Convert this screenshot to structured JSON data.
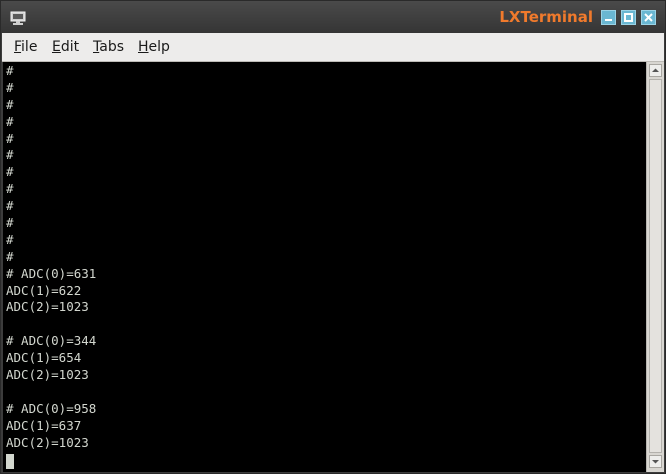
{
  "window": {
    "title": "LXTerminal",
    "title_color": "#f07a2c",
    "button_color": "#6ab7d2"
  },
  "menu": {
    "items": [
      {
        "mnemonic": "F",
        "rest": "ile"
      },
      {
        "mnemonic": "E",
        "rest": "dit"
      },
      {
        "mnemonic": "T",
        "rest": "abs"
      },
      {
        "mnemonic": "H",
        "rest": "elp"
      }
    ]
  },
  "terminal": {
    "background": "#000000",
    "foreground": "#d3d7cf",
    "lines": [
      "#",
      "#",
      "#",
      "#",
      "#",
      "#",
      "#",
      "#",
      "#",
      "#",
      "#",
      "#",
      "# ADC(0)=631",
      "ADC(1)=622",
      "ADC(2)=1023",
      "",
      "# ADC(0)=344",
      "ADC(1)=654",
      "ADC(2)=1023",
      "",
      "# ADC(0)=958",
      "ADC(1)=637",
      "ADC(2)=1023"
    ]
  },
  "icons": {
    "app": "terminal-monitor-icon",
    "minimize": "minimize-icon",
    "maximize": "maximize-icon",
    "close": "close-icon",
    "scroll_up": "arrow-up-icon",
    "scroll_down": "arrow-down-icon"
  }
}
